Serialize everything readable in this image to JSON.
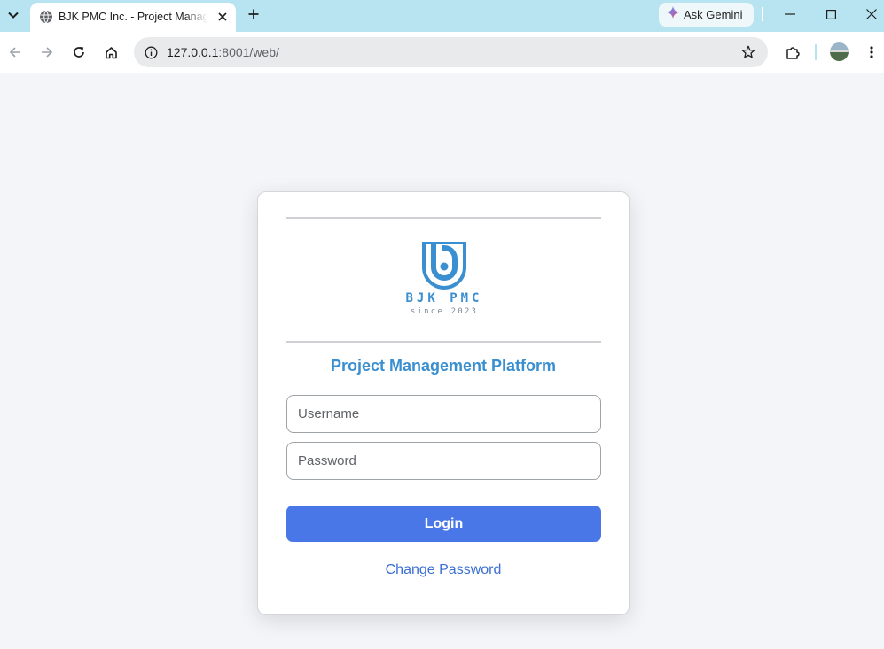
{
  "browser": {
    "tab_title": "BJK PMC Inc. - Project Management Platform",
    "ask_gemini_label": "Ask Gemini",
    "url_host": "127.0.0.1",
    "url_rest": ":8001/web/"
  },
  "login": {
    "logo_text": "BJK PMC",
    "logo_sub": "since 2023",
    "title": "Project Management Platform",
    "username_placeholder": "Username",
    "password_placeholder": "Password",
    "login_label": "Login",
    "change_password_label": "Change Password"
  },
  "colors": {
    "accent": "#3a8fd0",
    "button": "#4a77e8",
    "link": "#3b6fd4",
    "tabbar": "#b7e4f0",
    "page_bg": "#f3f5f9"
  }
}
